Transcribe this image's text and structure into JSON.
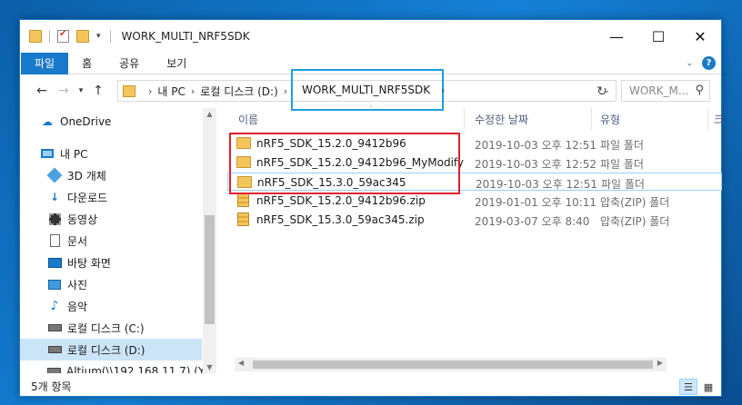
{
  "window": {
    "title": "WORK_MULTI_NRF5SDK",
    "controls": {
      "minimize": "—",
      "maximize": "☐",
      "close": "✕"
    }
  },
  "ribbon": {
    "tabs": [
      "파일",
      "홈",
      "공유",
      "보기"
    ]
  },
  "address": {
    "segments": [
      "내 PC",
      "로컬 디스크 (D:)"
    ],
    "current": "WORK_MULTI_NRF5SDK",
    "search_placeholder": "WORK_M..."
  },
  "nav_pane": {
    "items": [
      {
        "label": "OneDrive",
        "icon": "onedrive-icon"
      },
      {
        "label": "내 PC",
        "icon": "pc-icon"
      },
      {
        "label": "3D 개체",
        "icon": "cube-icon"
      },
      {
        "label": "다운로드",
        "icon": "download-icon"
      },
      {
        "label": "동영상",
        "icon": "video-icon"
      },
      {
        "label": "문서",
        "icon": "document-icon"
      },
      {
        "label": "바탕 화면",
        "icon": "desktop-icon"
      },
      {
        "label": "사진",
        "icon": "picture-icon"
      },
      {
        "label": "음악",
        "icon": "music-icon"
      },
      {
        "label": "로컬 디스크 (C:)",
        "icon": "drive-icon"
      },
      {
        "label": "로컬 디스크 (D:)",
        "icon": "drive-icon",
        "selected": true
      },
      {
        "label": "Altium(\\\\192.168.11.7) (Y",
        "icon": "network-drive-icon"
      }
    ]
  },
  "file_list": {
    "columns": [
      "이름",
      "수정한 날짜",
      "유형",
      "크"
    ],
    "rows": [
      {
        "name": "nRF5_SDK_15.2.0_9412b96",
        "date": "2019-10-03 오후 12:51",
        "type": "파일 폴더",
        "kind": "folder"
      },
      {
        "name": "nRF5_SDK_15.2.0_9412b96_MyModify",
        "date": "2019-10-03 오후 12:52",
        "type": "파일 폴더",
        "kind": "folder"
      },
      {
        "name": "nRF5_SDK_15.3.0_59ac345",
        "date": "2019-10-03 오후 12:51",
        "type": "파일 폴더",
        "kind": "folder",
        "selected": true
      },
      {
        "name": "nRF5_SDK_15.2.0_9412b96.zip",
        "date": "2019-01-01 오후 10:11",
        "type": "압축(ZIP) 폴더",
        "kind": "zip"
      },
      {
        "name": "nRF5_SDK_15.3.0_59ac345.zip",
        "date": "2019-03-07 오후 8:40",
        "type": "압축(ZIP) 폴더",
        "kind": "zip"
      }
    ]
  },
  "status": {
    "item_count": "5개 항목"
  },
  "colors": {
    "accent": "#1979ca",
    "highlight_box": "#e02030",
    "address_highlight": "#1e9ee0"
  }
}
